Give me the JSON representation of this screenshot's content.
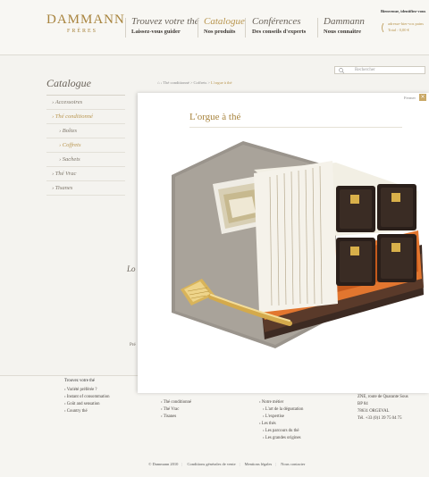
{
  "brand": {
    "name": "DAMMANN",
    "sub": "FRÈRES"
  },
  "nav": [
    {
      "title": "Trouvez votre thé",
      "sub": "Laissez-vous guider"
    },
    {
      "title": "Catalogue",
      "sub": "Nos produits"
    },
    {
      "title": "Conférences",
      "sub": "Des conseils d'experts"
    },
    {
      "title": "Dammann",
      "sub": "Nous connaître"
    }
  ],
  "account": {
    "title": "Bienvenue, identifiez-vous",
    "cart_line": "adresse-hier-vos pains",
    "total": "Total : 0,00 €"
  },
  "search": {
    "placeholder": "Rechercher"
  },
  "sidebar": {
    "title": "Catalogue",
    "items": [
      {
        "label": "Accessoires"
      },
      {
        "label": "Thé conditionné"
      },
      {
        "label": "Boîtes"
      },
      {
        "label": "Coffrets"
      },
      {
        "label": "Sachets"
      },
      {
        "label": "Thé Vrac"
      },
      {
        "label": "Tisanes"
      }
    ]
  },
  "breadcrumb": {
    "path": "Thé conditionné > Coffrets > ",
    "current": "L'orgue à thé"
  },
  "modal": {
    "title": "L'orgue à thé",
    "close_label": "Fermer",
    "close_icon": "×"
  },
  "left_fragments": {
    "a": "Lo",
    "b": "Pré"
  },
  "footer": {
    "col1_title": "Trouvez votre thé",
    "col1": [
      "Variété préférée ?",
      "Instant of consommation",
      "Goût and sensation",
      "Country thé"
    ],
    "col2": [
      "Thé conditionné",
      "Thé Vrac",
      "Tisanes"
    ],
    "col3": [
      "Notre métier",
      "L'art de la dégustation",
      "L'expertise",
      "Les thés",
      "Les parcours du thé",
      "Les grandes origines"
    ],
    "col4": [
      "ZNE, route de Quarante Sous",
      "BP 84",
      "78631 ORGEVAL",
      "Tél. +33 (0)1 39 75 04 75"
    ],
    "bottom": [
      "© Dammann 2010",
      "Conditions générales de vente",
      "Mentions légales",
      "Nous contacter"
    ]
  },
  "icons": {
    "close": "close-icon",
    "search": "search-icon",
    "cart": "cart-icon"
  }
}
